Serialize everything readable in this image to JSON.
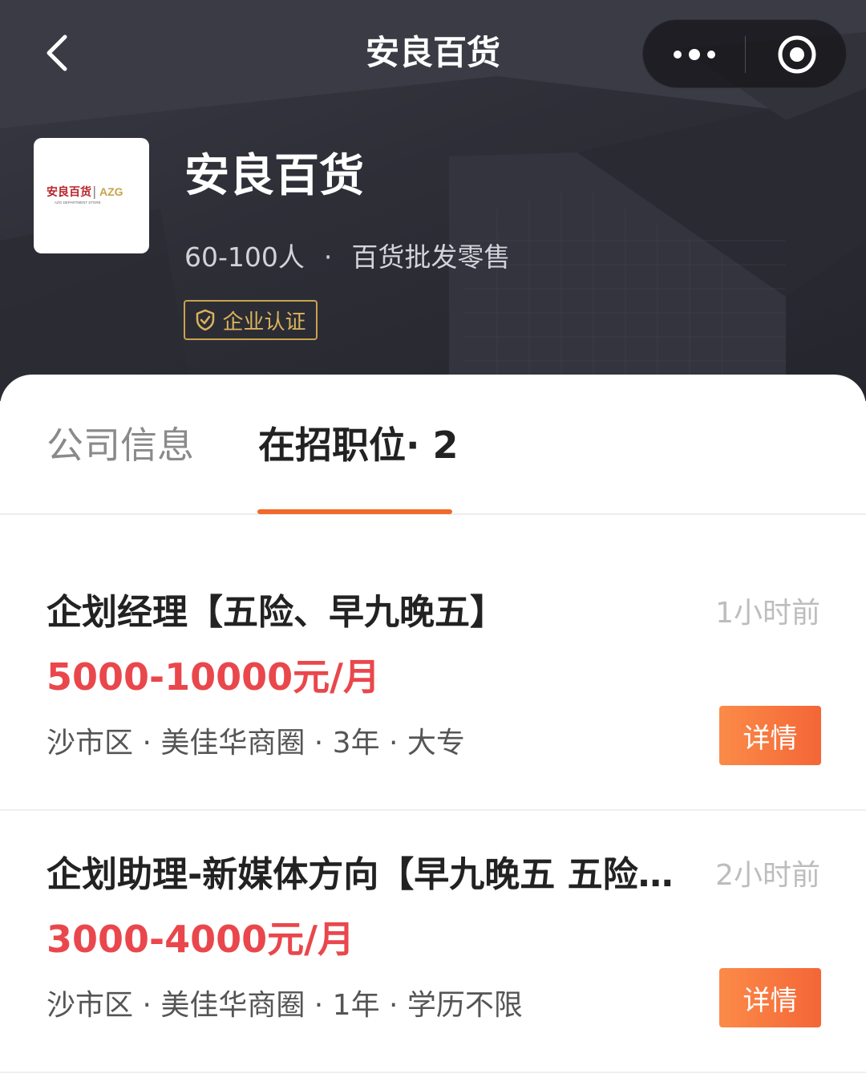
{
  "nav": {
    "title": "安良百货",
    "back_icon": "chevron-left-icon",
    "more_icon": "more-dots-icon",
    "close_icon": "target-circle-icon"
  },
  "company": {
    "name": "安良百货",
    "logo_text": "安良百货",
    "logo_brand": "AZG",
    "logo_subtitle": "AZG DEPARTMENT STORE",
    "size": "60-100人",
    "separator": "·",
    "industry": "百货批发零售",
    "verified_label": "企业认证"
  },
  "tabs": {
    "info": "公司信息",
    "jobs": "在招职位· 2"
  },
  "jobs": [
    {
      "title": "企划经理【五险、早九晚五】",
      "time": "1小时前",
      "salary": "5000-10000元/月",
      "meta": "沙市区 · 美佳华商圈 · 3年 · 大专",
      "button": "详情"
    },
    {
      "title": "企划助理-新媒体方向【早九晚五 五险…",
      "time": "2小时前",
      "salary": "3000-4000元/月",
      "meta": "沙市区 · 美佳华商圈 · 1年 · 学历不限",
      "button": "详情"
    }
  ],
  "colors": {
    "accent": "#f2692a",
    "salary": "#e9474c",
    "badge": "#c9a34b",
    "header_bg": "#2e2e37"
  }
}
